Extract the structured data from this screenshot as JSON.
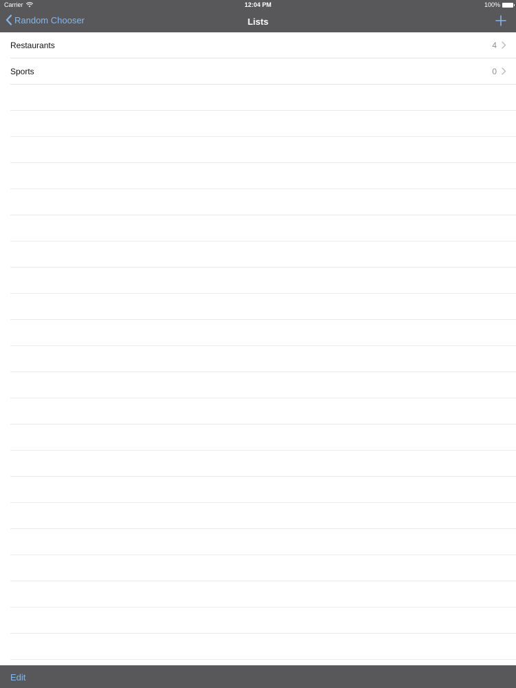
{
  "status_bar": {
    "carrier": "Carrier",
    "time": "12:04 PM",
    "battery": "100%"
  },
  "nav": {
    "back_label": "Random Chooser",
    "title": "Lists",
    "add_icon": "plus-icon"
  },
  "lists": [
    {
      "name": "Restaurants",
      "count": "4"
    },
    {
      "name": "Sports",
      "count": "0"
    }
  ],
  "toolbar": {
    "edit_label": "Edit"
  },
  "colors": {
    "bar_background": "#58585a",
    "accent": "#88b6e6",
    "separator": "#e3e3e6"
  }
}
